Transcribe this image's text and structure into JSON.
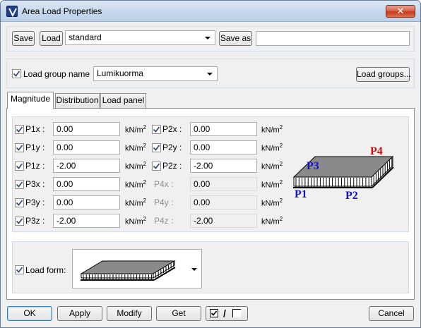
{
  "window": {
    "title": "Area Load Properties",
    "close_glyph": "✕"
  },
  "toolbar": {
    "save_label": "Save",
    "load_label": "Load",
    "preset_value": "standard",
    "save_as_label": "Save as",
    "save_as_value": ""
  },
  "load_group": {
    "label": "Load group name",
    "checked": true,
    "value": "Lumikuorma",
    "button_label": "Load groups..."
  },
  "tabs": [
    {
      "label": "Magnitude",
      "active": true
    },
    {
      "label": "Distribution",
      "active": false
    },
    {
      "label": "Load panel",
      "active": false
    }
  ],
  "magnitude": {
    "unit_base": "kN/m",
    "unit_exp": "2",
    "rows": [
      {
        "left": {
          "label": "P1x :",
          "value": "0.00",
          "checked": true
        },
        "right": {
          "label": "P2x :",
          "value": "0.00",
          "checked": true,
          "enabled": true
        }
      },
      {
        "left": {
          "label": "P1y :",
          "value": "0.00",
          "checked": true
        },
        "right": {
          "label": "P2y :",
          "value": "0.00",
          "checked": true,
          "enabled": true
        }
      },
      {
        "left": {
          "label": "P1z :",
          "value": "-2.00",
          "checked": true
        },
        "right": {
          "label": "P2z :",
          "value": "-2.00",
          "checked": true,
          "enabled": true
        }
      },
      {
        "left": {
          "label": "P3x :",
          "value": "0.00",
          "checked": true
        },
        "right": {
          "label": "P4x :",
          "value": "0.00",
          "checked": false,
          "enabled": false
        }
      },
      {
        "left": {
          "label": "P3y :",
          "value": "0.00",
          "checked": true
        },
        "right": {
          "label": "P4y :",
          "value": "0.00",
          "checked": false,
          "enabled": false
        }
      },
      {
        "left": {
          "label": "P3z :",
          "value": "-2.00",
          "checked": true
        },
        "right": {
          "label": "P4z :",
          "value": "-2.00",
          "checked": false,
          "enabled": false
        }
      }
    ],
    "diagram_labels": {
      "p1": "P1",
      "p2": "P2",
      "p3": "P3",
      "p4": "P4"
    },
    "colors": {
      "p1": "#1010c8",
      "p2": "#1010c8",
      "p3": "#1010c8",
      "p4": "#d01010"
    }
  },
  "load_form": {
    "label": "Load form:",
    "checked": true
  },
  "footer": {
    "ok_label": "OK",
    "apply_label": "Apply",
    "modify_label": "Modify",
    "get_label": "Get",
    "toggle_slash": "/",
    "cancel_label": "Cancel"
  }
}
